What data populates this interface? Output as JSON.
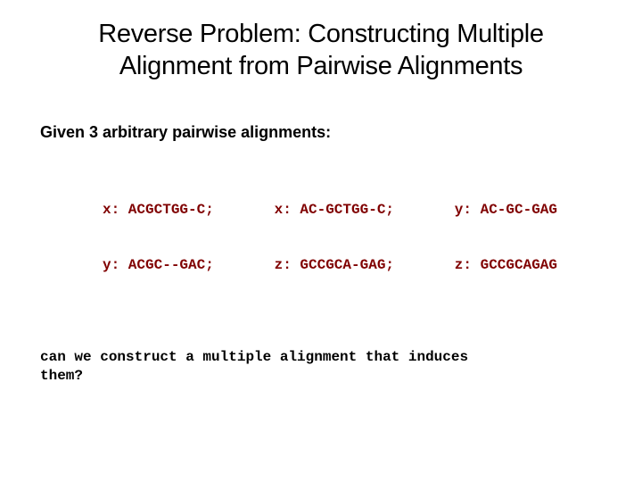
{
  "title_line1": "Reverse Problem: Constructing Multiple",
  "title_line2": "Alignment from Pairwise Alignments",
  "subtitle": "Given 3 arbitrary pairwise alignments:",
  "alignments": [
    {
      "line1": "x: ACGCTGG-C;",
      "line2": "y: ACGC--GAC;"
    },
    {
      "line1": "x: AC-GCTGG-C;",
      "line2": "z: GCCGCA-GAG;"
    },
    {
      "line1": "y: AC-GC-GAG",
      "line2": "z: GCCGCAGAG"
    }
  ],
  "question_line1": "can we construct a multiple alignment that induces",
  "question_line2": "them?"
}
